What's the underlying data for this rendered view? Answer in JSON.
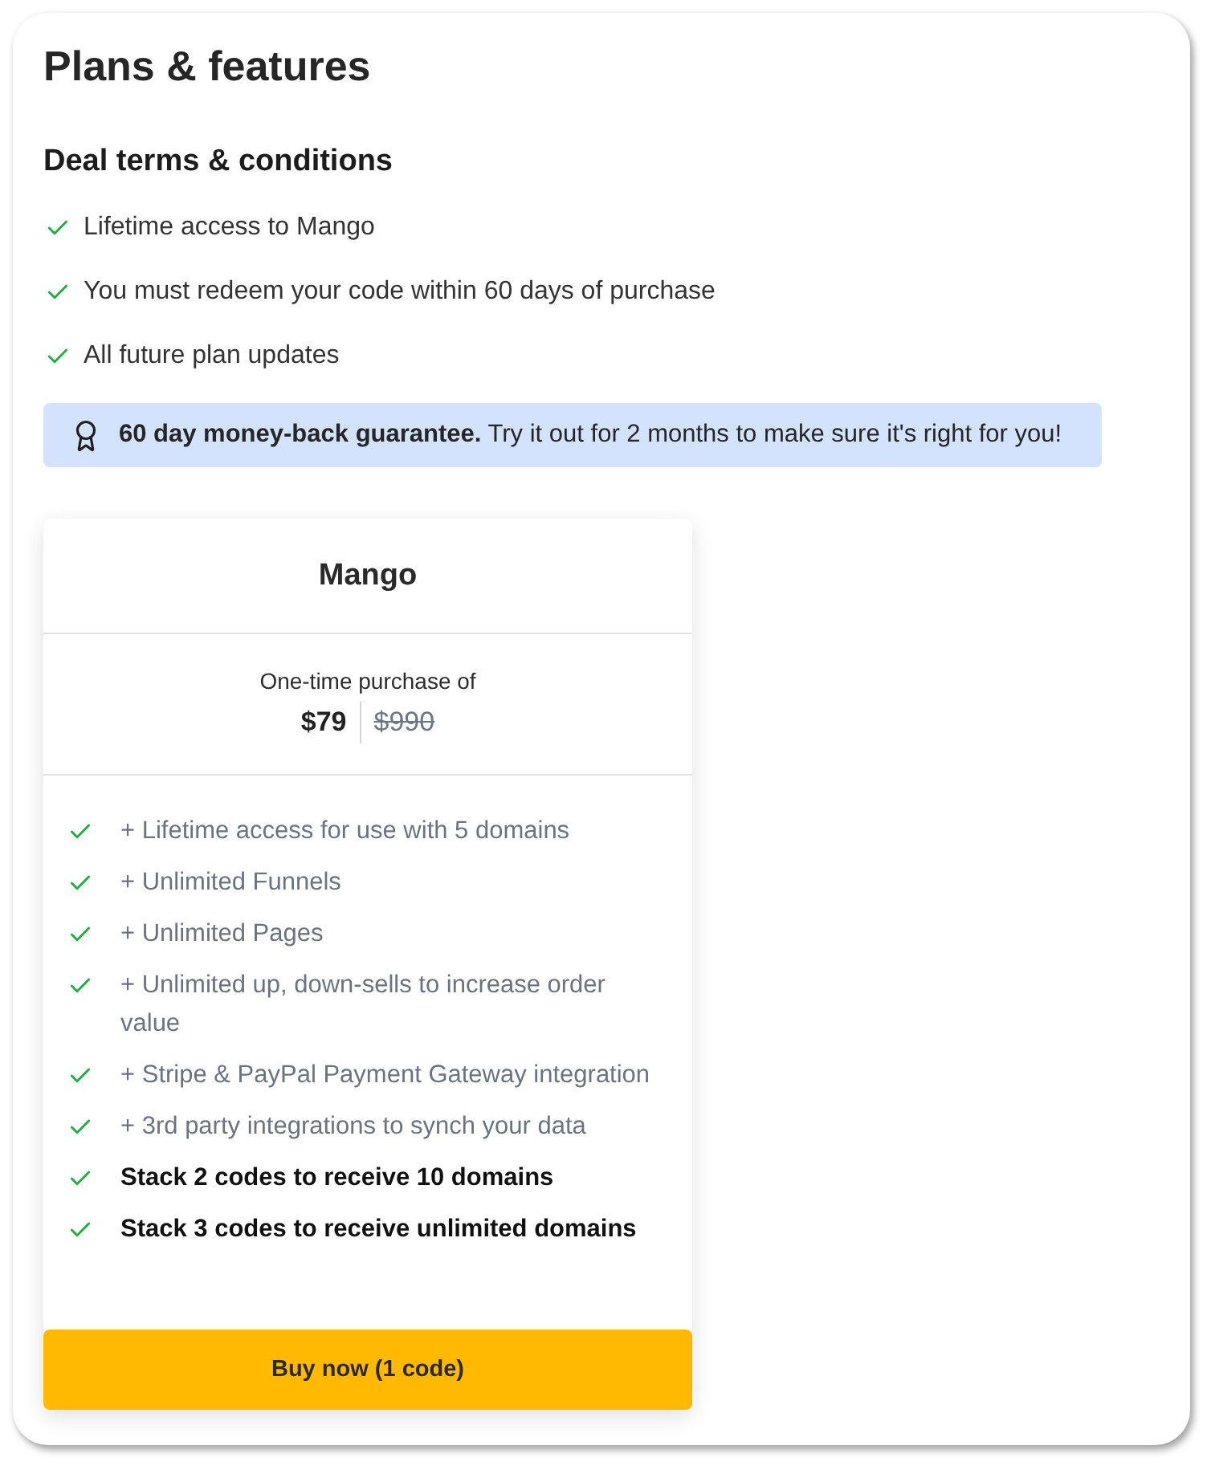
{
  "title": "Plans & features",
  "terms": {
    "heading": "Deal terms & conditions",
    "items": [
      "Lifetime access to Mango",
      "You must redeem your code within 60 days of purchase",
      "All future plan updates"
    ]
  },
  "guarantee": {
    "text": "**60 day money-back guarantee.** Try it out for 2 months to make sure it's right for you!"
  },
  "plan": {
    "name": "Mango",
    "price_caption": "One-time purchase of",
    "price": "$79",
    "original_price": "$990",
    "features": [
      {
        "text": "+ Lifetime access for use with 5 domains",
        "emphasized": false
      },
      {
        "text": "+ Unlimited Funnels",
        "emphasized": false
      },
      {
        "text": "+ Unlimited Pages",
        "emphasized": false
      },
      {
        "text": "+ Unlimited up, down-sells to increase order value",
        "emphasized": false
      },
      {
        "text": "+ Stripe & PayPal Payment Gateway integration",
        "emphasized": false
      },
      {
        "text": "+ 3rd party integrations to synch your data",
        "emphasized": false
      },
      {
        "text": "Stack 2 codes to receive 10 domains",
        "emphasized": true
      },
      {
        "text": "Stack 3 codes to receive unlimited domains",
        "emphasized": true
      }
    ],
    "button": "Buy now (1 code)"
  }
}
